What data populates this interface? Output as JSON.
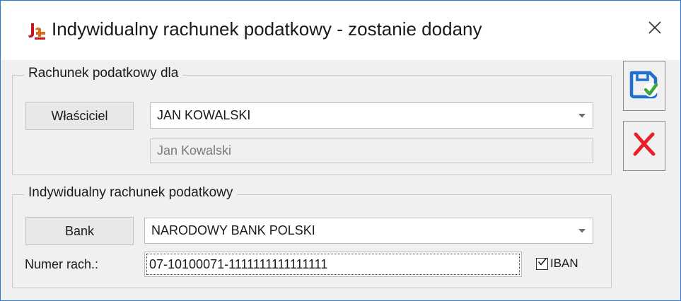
{
  "window": {
    "title": "Indywidualny rachunek podatkowy - zostanie dodany"
  },
  "icons": {
    "app": "app-logo-icon",
    "close": "close-icon",
    "save": "save-disk-check-icon",
    "cancel": "red-x-cancel-icon",
    "dropdown": "chevron-down-icon",
    "checkmark": "checkmark-icon"
  },
  "colors": {
    "window_border": "#2b79d7",
    "save_blue": "#1f6fd1",
    "save_green": "#3aa83a",
    "cancel_red": "#e8202a"
  },
  "owner_group": {
    "legend": "Rachunek podatkowy dla",
    "owner_button": "Właściciel",
    "owner_value": "JAN KOWALSKI",
    "owner_name": "Jan Kowalski"
  },
  "account_group": {
    "legend": "Indywidualny rachunek podatkowy",
    "bank_button": "Bank",
    "bank_value": "NARODOWY BANK POLSKI",
    "account_label": "Numer rach.:",
    "account_value": "07-10100071-1111111111111111",
    "iban_label": "IBAN",
    "iban_checked": true
  }
}
